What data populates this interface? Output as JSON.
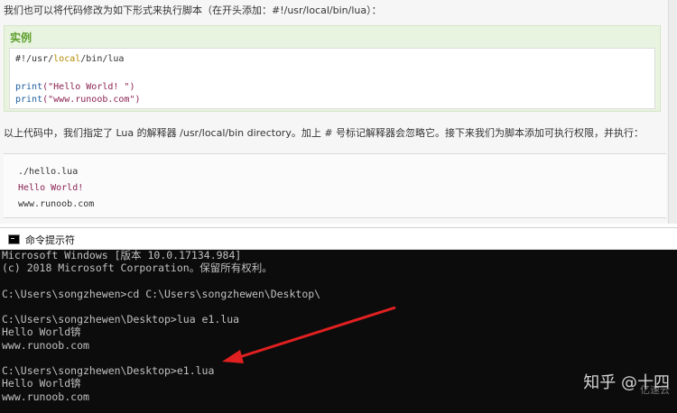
{
  "page": {
    "intro": "我们也可以将代码修改为如下形式来执行脚本（在开头添加：#!/usr/local/bin/lua）：",
    "example_title": "实例",
    "code": {
      "shebang_pre": "#!/usr/",
      "shebang_kw": "local",
      "shebang_post": "/bin/lua",
      "line2_fn": "print",
      "line2_str": "(\"Hello World! \")",
      "line3_fn": "print",
      "line3_str": "(\"www.runoob.com\")"
    },
    "description": "以上代码中，我们指定了 Lua 的解释器 /usr/local/bin directory。加上 # 号标记解释器会忽略它。接下来我们为脚本添加可执行权限，并执行：",
    "output": {
      "line1": "./hello.lua",
      "line2": "Hello World!",
      "line3": "www.runoob.com"
    }
  },
  "cmd": {
    "title": "命令提示符",
    "icon": "terminal-icon",
    "lines": [
      "Microsoft Windows [版本 10.0.17134.984]",
      "(c) 2018 Microsoft Corporation。保留所有权利。",
      "",
      "C:\\Users\\songzhewen>cd C:\\Users\\songzhewen\\Desktop\\",
      "",
      "C:\\Users\\songzhewen\\Desktop>lua e1.lua",
      "Hello World锛",
      "www.runoob.com",
      "",
      "C:\\Users\\songzhewen\\Desktop>e1.lua",
      "Hello World锛",
      "www.runoob.com"
    ]
  },
  "annotation": {
    "arrow_color": "#e02020"
  },
  "watermark": {
    "text": "知乎 @十四",
    "sub": "亿速云"
  },
  "colors": {
    "example_bg": "#e8f3e0",
    "example_title": "#5c9f2b",
    "console_bg": "#0c0c0c",
    "console_fg": "#c0c0c0"
  }
}
